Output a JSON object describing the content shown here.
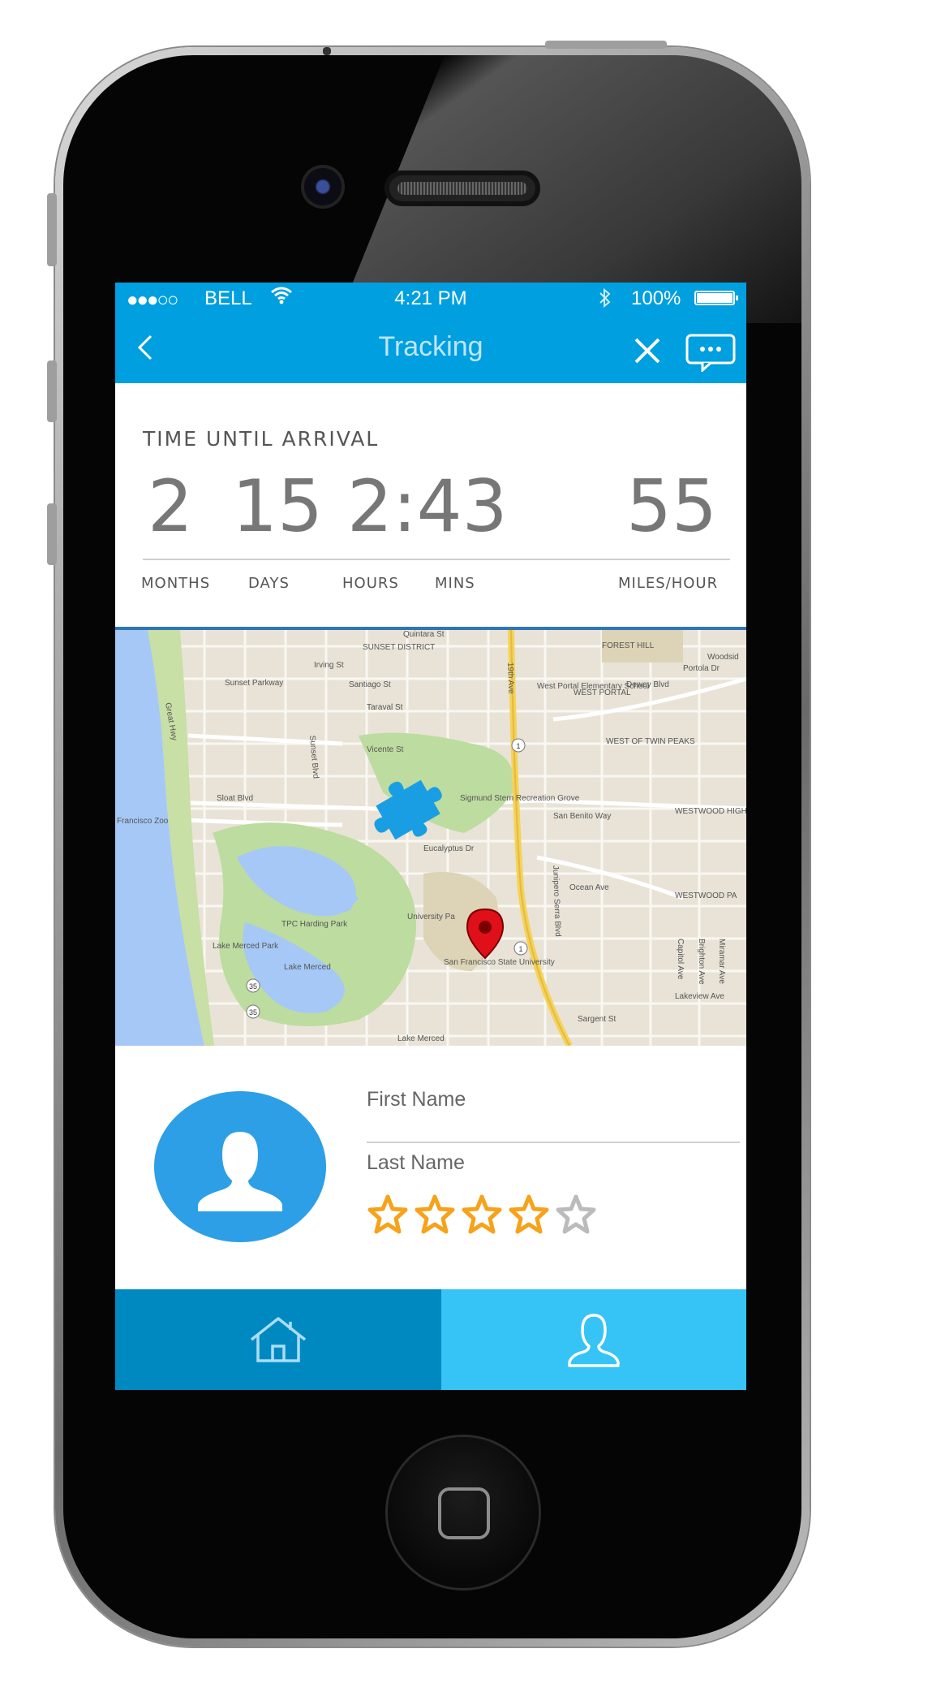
{
  "status_bar": {
    "signal": "●●●○○",
    "carrier": "BELL",
    "wifi_icon": "wifi-icon",
    "time": "4:21 PM",
    "bluetooth_icon": "bluetooth-icon",
    "battery_pct": "100%"
  },
  "nav": {
    "title": "Tracking"
  },
  "arrival": {
    "label": "TIME UNTIL ARRIVAL",
    "months": "2",
    "days": "15",
    "hours_mins": "2:43",
    "speed": "55",
    "unit_months": "MONTHS",
    "unit_days": "DAYS",
    "unit_hours": "HOURS",
    "unit_mins": "MINS",
    "unit_speed": "MILES/HOUR"
  },
  "map": {
    "labels": {
      "sunset_district": "SUNSET DISTRICT",
      "forest_hill": "FOREST HILL",
      "woodside": "Woodsid",
      "sunset_parkway": "Sunset Parkway",
      "irving": "Irving St",
      "santiago": "Santiago St",
      "taraval": "Taraval St",
      "vicente": "Vicente St",
      "quintara": "Quintara St",
      "west_portal_school": "West Portal\nElementary School",
      "west_portal": "WEST PORTAL",
      "west_twin_peaks": "WEST OF TWIN PEAKS",
      "westwood_high": "WESTWOOD HIGH",
      "westwood_park": "WESTWOOD PA",
      "sloat": "Sloat Blvd",
      "sf_zoo": "Francisco Zoo",
      "sigmund_stern": "Sigmund Stern\nRecreation Grove",
      "eucalyptus": "Eucalyptus Dr",
      "ocean_ave": "Ocean Ave",
      "tpc_harding": "TPC Harding Park",
      "lake_merced_park": "Lake Merced Park",
      "lake_merced": "Lake Merced",
      "university_park": "University Pa",
      "sfsu": "San Francisco\nState University",
      "lake_merced_blvd": "Lake Merced",
      "great_hwy": "Great Hwy",
      "sunset_blvd": "Sunset Blvd",
      "nineteenth_ave": "19th Ave",
      "junipero_serra": "Junipero Serra Blvd",
      "portola": "Portola Dr",
      "dewey": "Dewey Blvd",
      "san_benito": "San Benito Way",
      "lakeview": "Lakeview Ave",
      "sargent": "Sargent St",
      "brighton": "Brighton Ave",
      "miramar": "Miramar Ave",
      "capitol": "Capitol Ave",
      "route1": "1",
      "route35": "35"
    }
  },
  "driver": {
    "first_name": "First Name",
    "last_name": "Last Name",
    "rating": 4,
    "rating_max": 5
  },
  "colors": {
    "primary": "#009fdf",
    "tab_active": "#0089c1",
    "tab_inactive": "#36c3f6",
    "star_filled": "#f7a21b",
    "star_empty": "#bbbbbb",
    "avatar": "#2c9fe6"
  },
  "tabs": [
    {
      "icon": "home-icon"
    },
    {
      "icon": "user-icon"
    }
  ]
}
